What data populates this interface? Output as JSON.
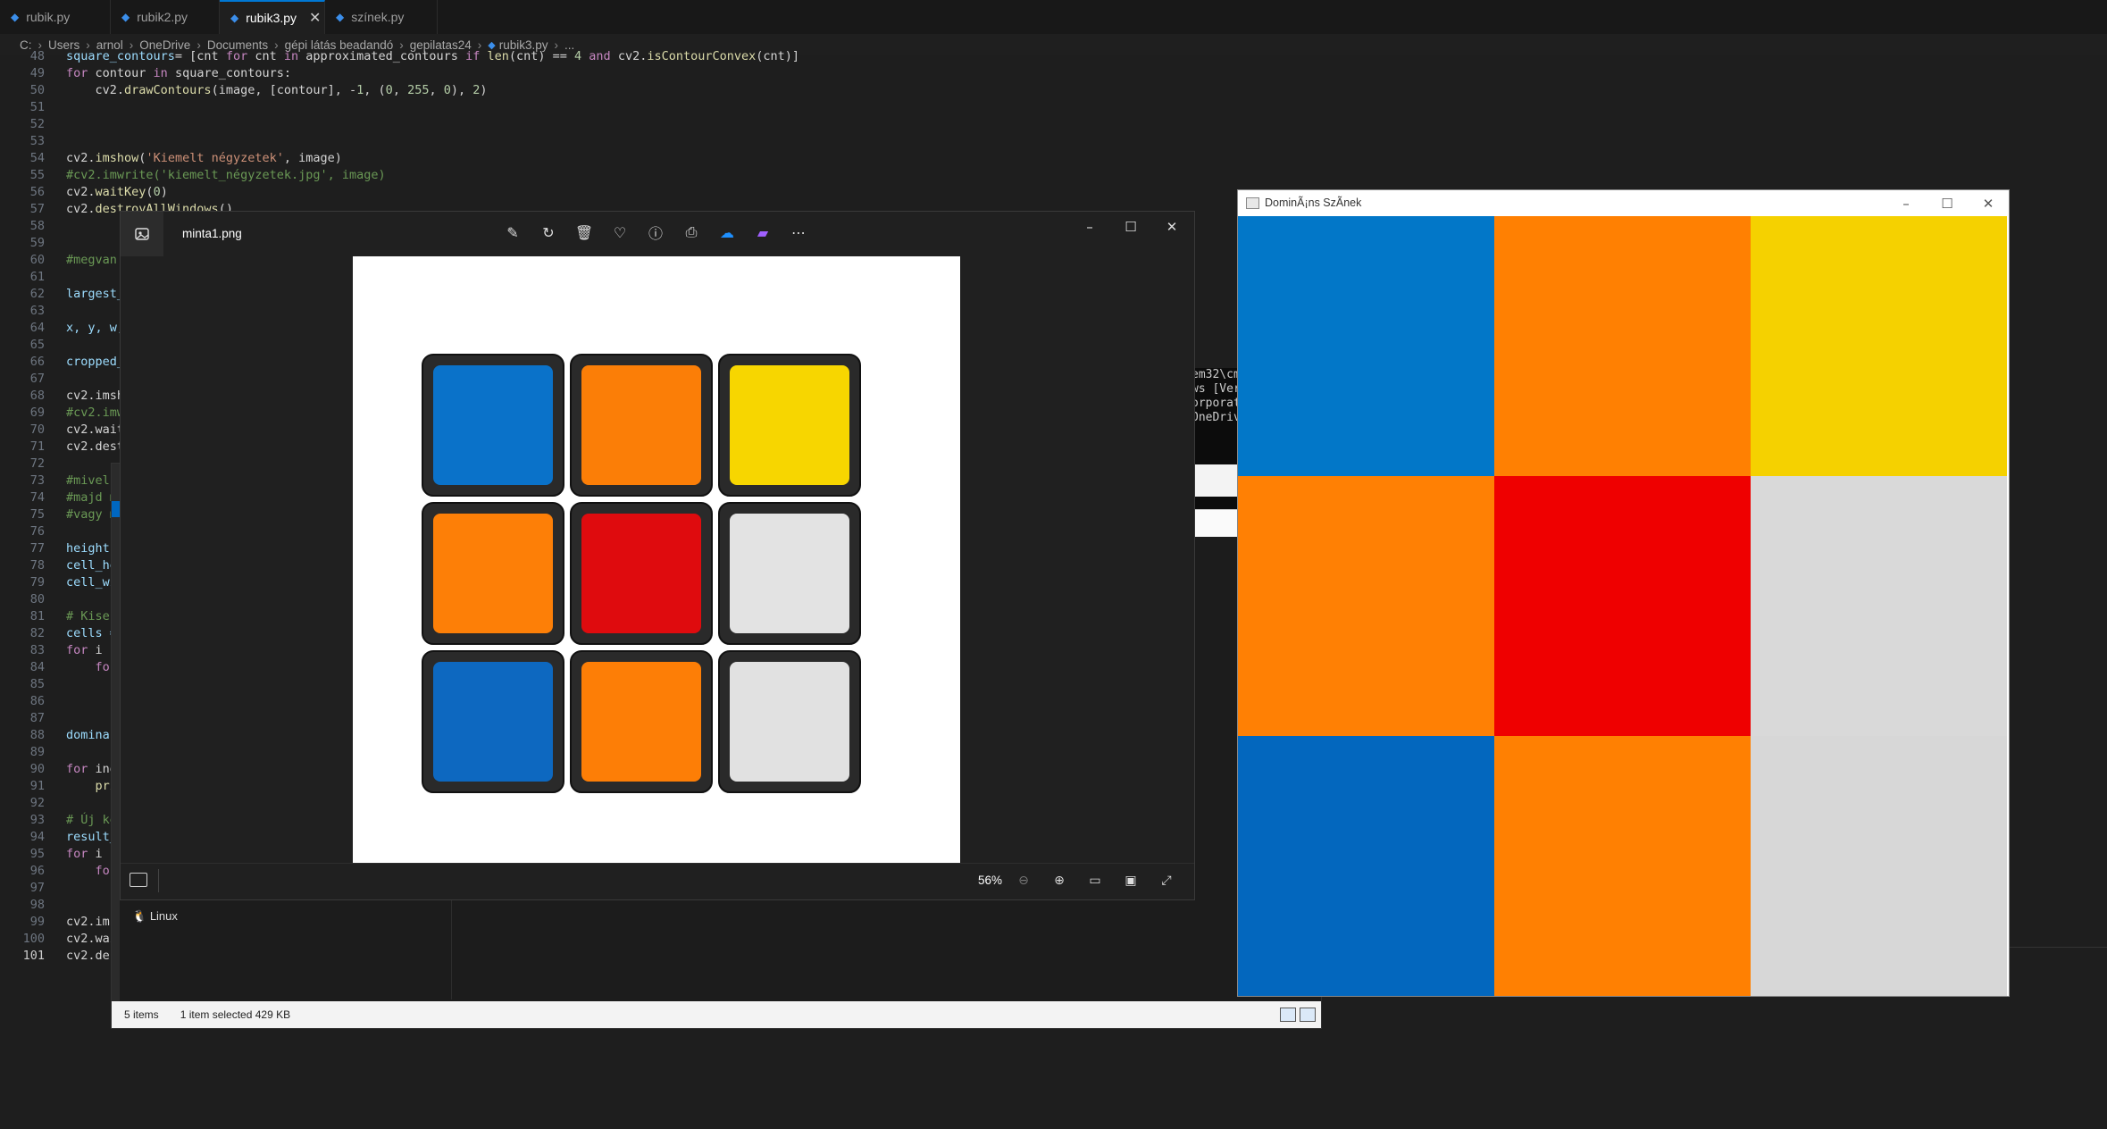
{
  "editor": {
    "tabs": [
      {
        "label": "rubik.py",
        "active": false
      },
      {
        "label": "rubik2.py",
        "active": false
      },
      {
        "label": "rubik3.py",
        "active": true
      },
      {
        "label": "színek.py",
        "active": false
      }
    ],
    "breadcrumb": [
      "C:",
      "Users",
      "arnol",
      "OneDrive",
      "Documents",
      "gépi látás beadandó",
      "gepilatas24",
      "rubik3.py",
      "..."
    ],
    "lines": [
      {
        "n": "48",
        "segs": [
          [
            "vr",
            "square_contours"
          ],
          [
            "",
            "= [cnt "
          ],
          [
            "kw",
            "for"
          ],
          [
            "",
            " cnt "
          ],
          [
            "kw",
            "in"
          ],
          [
            "",
            " approximated_contours "
          ],
          [
            "kw",
            "if"
          ],
          [
            "",
            " "
          ],
          [
            "fn",
            "len"
          ],
          [
            "",
            "(cnt) == "
          ],
          [
            "num",
            "4"
          ],
          [
            "",
            " "
          ],
          [
            "kw",
            "and"
          ],
          [
            "",
            " cv2."
          ],
          [
            "fn",
            "isContourConvex"
          ],
          [
            "",
            "(cnt)]"
          ]
        ]
      },
      {
        "n": "49",
        "segs": [
          [
            "kw",
            "for"
          ],
          [
            "",
            " contour "
          ],
          [
            "kw",
            "in"
          ],
          [
            "",
            " square_contours:"
          ]
        ]
      },
      {
        "n": "50",
        "segs": [
          [
            "",
            "    cv2."
          ],
          [
            "fn",
            "drawContours"
          ],
          [
            "",
            "(image, [contour], -"
          ],
          [
            "num",
            "1"
          ],
          [
            "",
            ", ("
          ],
          [
            "num",
            "0"
          ],
          [
            "",
            ", "
          ],
          [
            "num",
            "255"
          ],
          [
            "",
            ", "
          ],
          [
            "num",
            "0"
          ],
          [
            "",
            "), "
          ],
          [
            "num",
            "2"
          ],
          [
            "",
            ")"
          ]
        ]
      },
      {
        "n": "51",
        "segs": []
      },
      {
        "n": "52",
        "segs": []
      },
      {
        "n": "53",
        "segs": []
      },
      {
        "n": "54",
        "segs": [
          [
            "",
            "cv2."
          ],
          [
            "fn",
            "imshow"
          ],
          [
            "",
            "("
          ],
          [
            "str",
            "'Kiemelt négyzetek'"
          ],
          [
            "",
            ", image)"
          ]
        ]
      },
      {
        "n": "55",
        "segs": [
          [
            "cm",
            "#cv2.imwrite('kiemelt_négyzetek.jpg', image)"
          ]
        ]
      },
      {
        "n": "56",
        "segs": [
          [
            "",
            "cv2."
          ],
          [
            "fn",
            "waitKey"
          ],
          [
            "",
            "("
          ],
          [
            "num",
            "0"
          ],
          [
            "",
            ")"
          ]
        ]
      },
      {
        "n": "57",
        "segs": [
          [
            "",
            "cv2."
          ],
          [
            "fn",
            "destroyAllWindows"
          ],
          [
            "",
            "()"
          ]
        ]
      },
      {
        "n": "58",
        "segs": []
      },
      {
        "n": "59",
        "segs": []
      },
      {
        "n": "60",
        "segs": [
          [
            "cm",
            "#megvan"
          ]
        ]
      },
      {
        "n": "61",
        "segs": []
      },
      {
        "n": "62",
        "segs": [
          [
            "vr",
            "largest_"
          ]
        ]
      },
      {
        "n": "63",
        "segs": []
      },
      {
        "n": "64",
        "segs": [
          [
            "vr",
            "x, y, w,"
          ]
        ]
      },
      {
        "n": "65",
        "segs": []
      },
      {
        "n": "66",
        "segs": [
          [
            "vr",
            "cropped_"
          ]
        ]
      },
      {
        "n": "67",
        "segs": []
      },
      {
        "n": "68",
        "segs": [
          [
            "",
            "cv2.imsh"
          ]
        ]
      },
      {
        "n": "69",
        "segs": [
          [
            "cm",
            "#cv2.imw"
          ]
        ]
      },
      {
        "n": "70",
        "segs": [
          [
            "",
            "cv2.wait"
          ]
        ]
      },
      {
        "n": "71",
        "segs": [
          [
            "",
            "cv2.dest"
          ]
        ]
      },
      {
        "n": "72",
        "segs": []
      },
      {
        "n": "73",
        "segs": [
          [
            "cm",
            "#mivel"
          ]
        ]
      },
      {
        "n": "74",
        "segs": [
          [
            "cm",
            "#majd m"
          ]
        ]
      },
      {
        "n": "75",
        "segs": [
          [
            "cm",
            "#vagy m"
          ]
        ]
      },
      {
        "n": "76",
        "segs": []
      },
      {
        "n": "77",
        "segs": [
          [
            "vr",
            "height,"
          ]
        ]
      },
      {
        "n": "78",
        "segs": [
          [
            "vr",
            "cell_he"
          ]
        ]
      },
      {
        "n": "79",
        "segs": [
          [
            "vr",
            "cell_wi"
          ]
        ]
      },
      {
        "n": "80",
        "segs": []
      },
      {
        "n": "81",
        "segs": [
          [
            "cm",
            "# Kiseb"
          ]
        ]
      },
      {
        "n": "82",
        "segs": [
          [
            "vr",
            "cells ="
          ]
        ]
      },
      {
        "n": "83",
        "segs": [
          [
            "kw",
            "for"
          ],
          [
            "",
            " i "
          ]
        ]
      },
      {
        "n": "84",
        "segs": [
          [
            "kw",
            "    for"
          ]
        ]
      },
      {
        "n": "85",
        "segs": []
      },
      {
        "n": "86",
        "segs": []
      },
      {
        "n": "87",
        "segs": []
      },
      {
        "n": "88",
        "segs": [
          [
            "vr",
            "dominan"
          ]
        ]
      },
      {
        "n": "89",
        "segs": []
      },
      {
        "n": "90",
        "segs": [
          [
            "kw",
            "for"
          ],
          [
            "",
            " ind"
          ]
        ]
      },
      {
        "n": "91",
        "segs": [
          [
            "fn",
            "    pri"
          ]
        ]
      },
      {
        "n": "92",
        "segs": []
      },
      {
        "n": "93",
        "segs": [
          [
            "cm",
            "# Új ké"
          ]
        ]
      },
      {
        "n": "94",
        "segs": [
          [
            "vr",
            "result_"
          ]
        ]
      },
      {
        "n": "95",
        "segs": [
          [
            "kw",
            "for"
          ],
          [
            "",
            " i "
          ]
        ]
      },
      {
        "n": "96",
        "segs": [
          [
            "kw",
            "    for"
          ]
        ]
      },
      {
        "n": "97",
        "segs": []
      },
      {
        "n": "98",
        "segs": []
      },
      {
        "n": "99",
        "segs": [
          [
            "",
            "cv2.ims"
          ]
        ]
      },
      {
        "n": "100",
        "segs": [
          [
            "",
            "cv2.wai"
          ]
        ]
      },
      {
        "n": "101",
        "segs": [
          [
            "",
            "cv2.des"
          ]
        ]
      }
    ],
    "current_line": "101"
  },
  "explorer": {
    "items_count": "5 items",
    "selection": "1 item selected  429 KB",
    "nav_item": "Linux"
  },
  "cmd": {
    "lines": [
      "em32\\cm",
      "ws [Ver",
      "orporat",
      "",
      "OneDriv"
    ]
  },
  "photos": {
    "file_name": "minta1.png",
    "zoom": "56%",
    "toolbar_icons": [
      "edit-icon",
      "rotate-icon",
      "delete-icon",
      "favorite-icon",
      "info-icon",
      "print-icon",
      "onedrive-icon",
      "clipchamp-icon",
      "more-icon"
    ],
    "cube": {
      "background": "#ffffff",
      "body": "#2a2a2a",
      "stickers": [
        [
          "#0a72c9",
          "#fb7e07",
          "#f7d600"
        ],
        [
          "#fd7f07",
          "#df0b0e",
          "#e3e3e3"
        ],
        [
          "#0d68c0",
          "#fd7e06",
          "#e1e1e1"
        ]
      ]
    }
  },
  "dominant_window": {
    "title": "DominÃ¡ns SzÃ­nek",
    "colors": [
      [
        "#0277c8",
        "#ff8002",
        "#f5d100"
      ],
      [
        "#ff8004",
        "#ef0000",
        "#d9d9d9"
      ],
      [
        "#0367be",
        "#ff8002",
        "#d7d7d7"
      ]
    ]
  }
}
